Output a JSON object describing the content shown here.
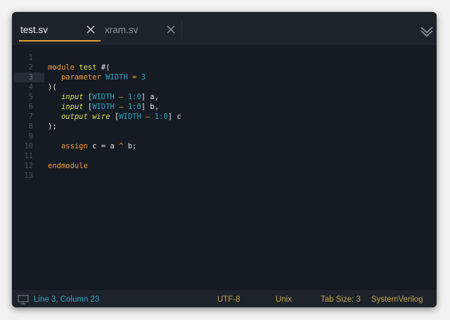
{
  "tabs": [
    {
      "label": "test.sv",
      "active": true
    },
    {
      "label": "xram.sv",
      "active": false
    }
  ],
  "editor": {
    "current_line": 3,
    "line_numbers": [
      "1",
      "2",
      "3",
      "4",
      "5",
      "6",
      "7",
      "8",
      "9",
      "10",
      "11",
      "12",
      "13"
    ]
  },
  "code": {
    "l2": {
      "kw": "module",
      "name": "test",
      "tail": " #("
    },
    "l3": {
      "kw": "parameter",
      "name": "WIDTH",
      "op": " = ",
      "val": "3"
    },
    "l4": {
      "text": ")("
    },
    "l5": {
      "dir": "input",
      "open": " [",
      "name": "WIDTH",
      "op": " – ",
      "range": "1:0",
      "close": "] a,"
    },
    "l6": {
      "dir": "input",
      "open": " [",
      "name": "WIDTH",
      "op": " – ",
      "range": "1:0",
      "close": "] b,"
    },
    "l7": {
      "dir": "output",
      "type": "wire",
      "open": " [",
      "name": "WIDTH",
      "op": " – ",
      "range": "1:0",
      "close": "] c"
    },
    "l8": {
      "text": ");"
    },
    "l10": {
      "kw": "assign",
      "text": " c = a ",
      "op": "^",
      "tail": " b;"
    },
    "l12": {
      "kw": "endmodule"
    }
  },
  "status": {
    "position": "Line 3, Column 23",
    "encoding": "UTF-8",
    "line_endings": "Unix",
    "tab_size": "Tab Size: 3",
    "language": "SystemVerilog"
  },
  "icons": {
    "tab_close": "close-icon",
    "overflow": "chevron-double-down-icon",
    "panel": "monitor-icon"
  },
  "colors": {
    "keyword": "#f29a3a",
    "identifier": "#d7e35a",
    "constant": "#2aa7c4",
    "accent": "#e8a032",
    "status_text": "#c9a24a"
  }
}
